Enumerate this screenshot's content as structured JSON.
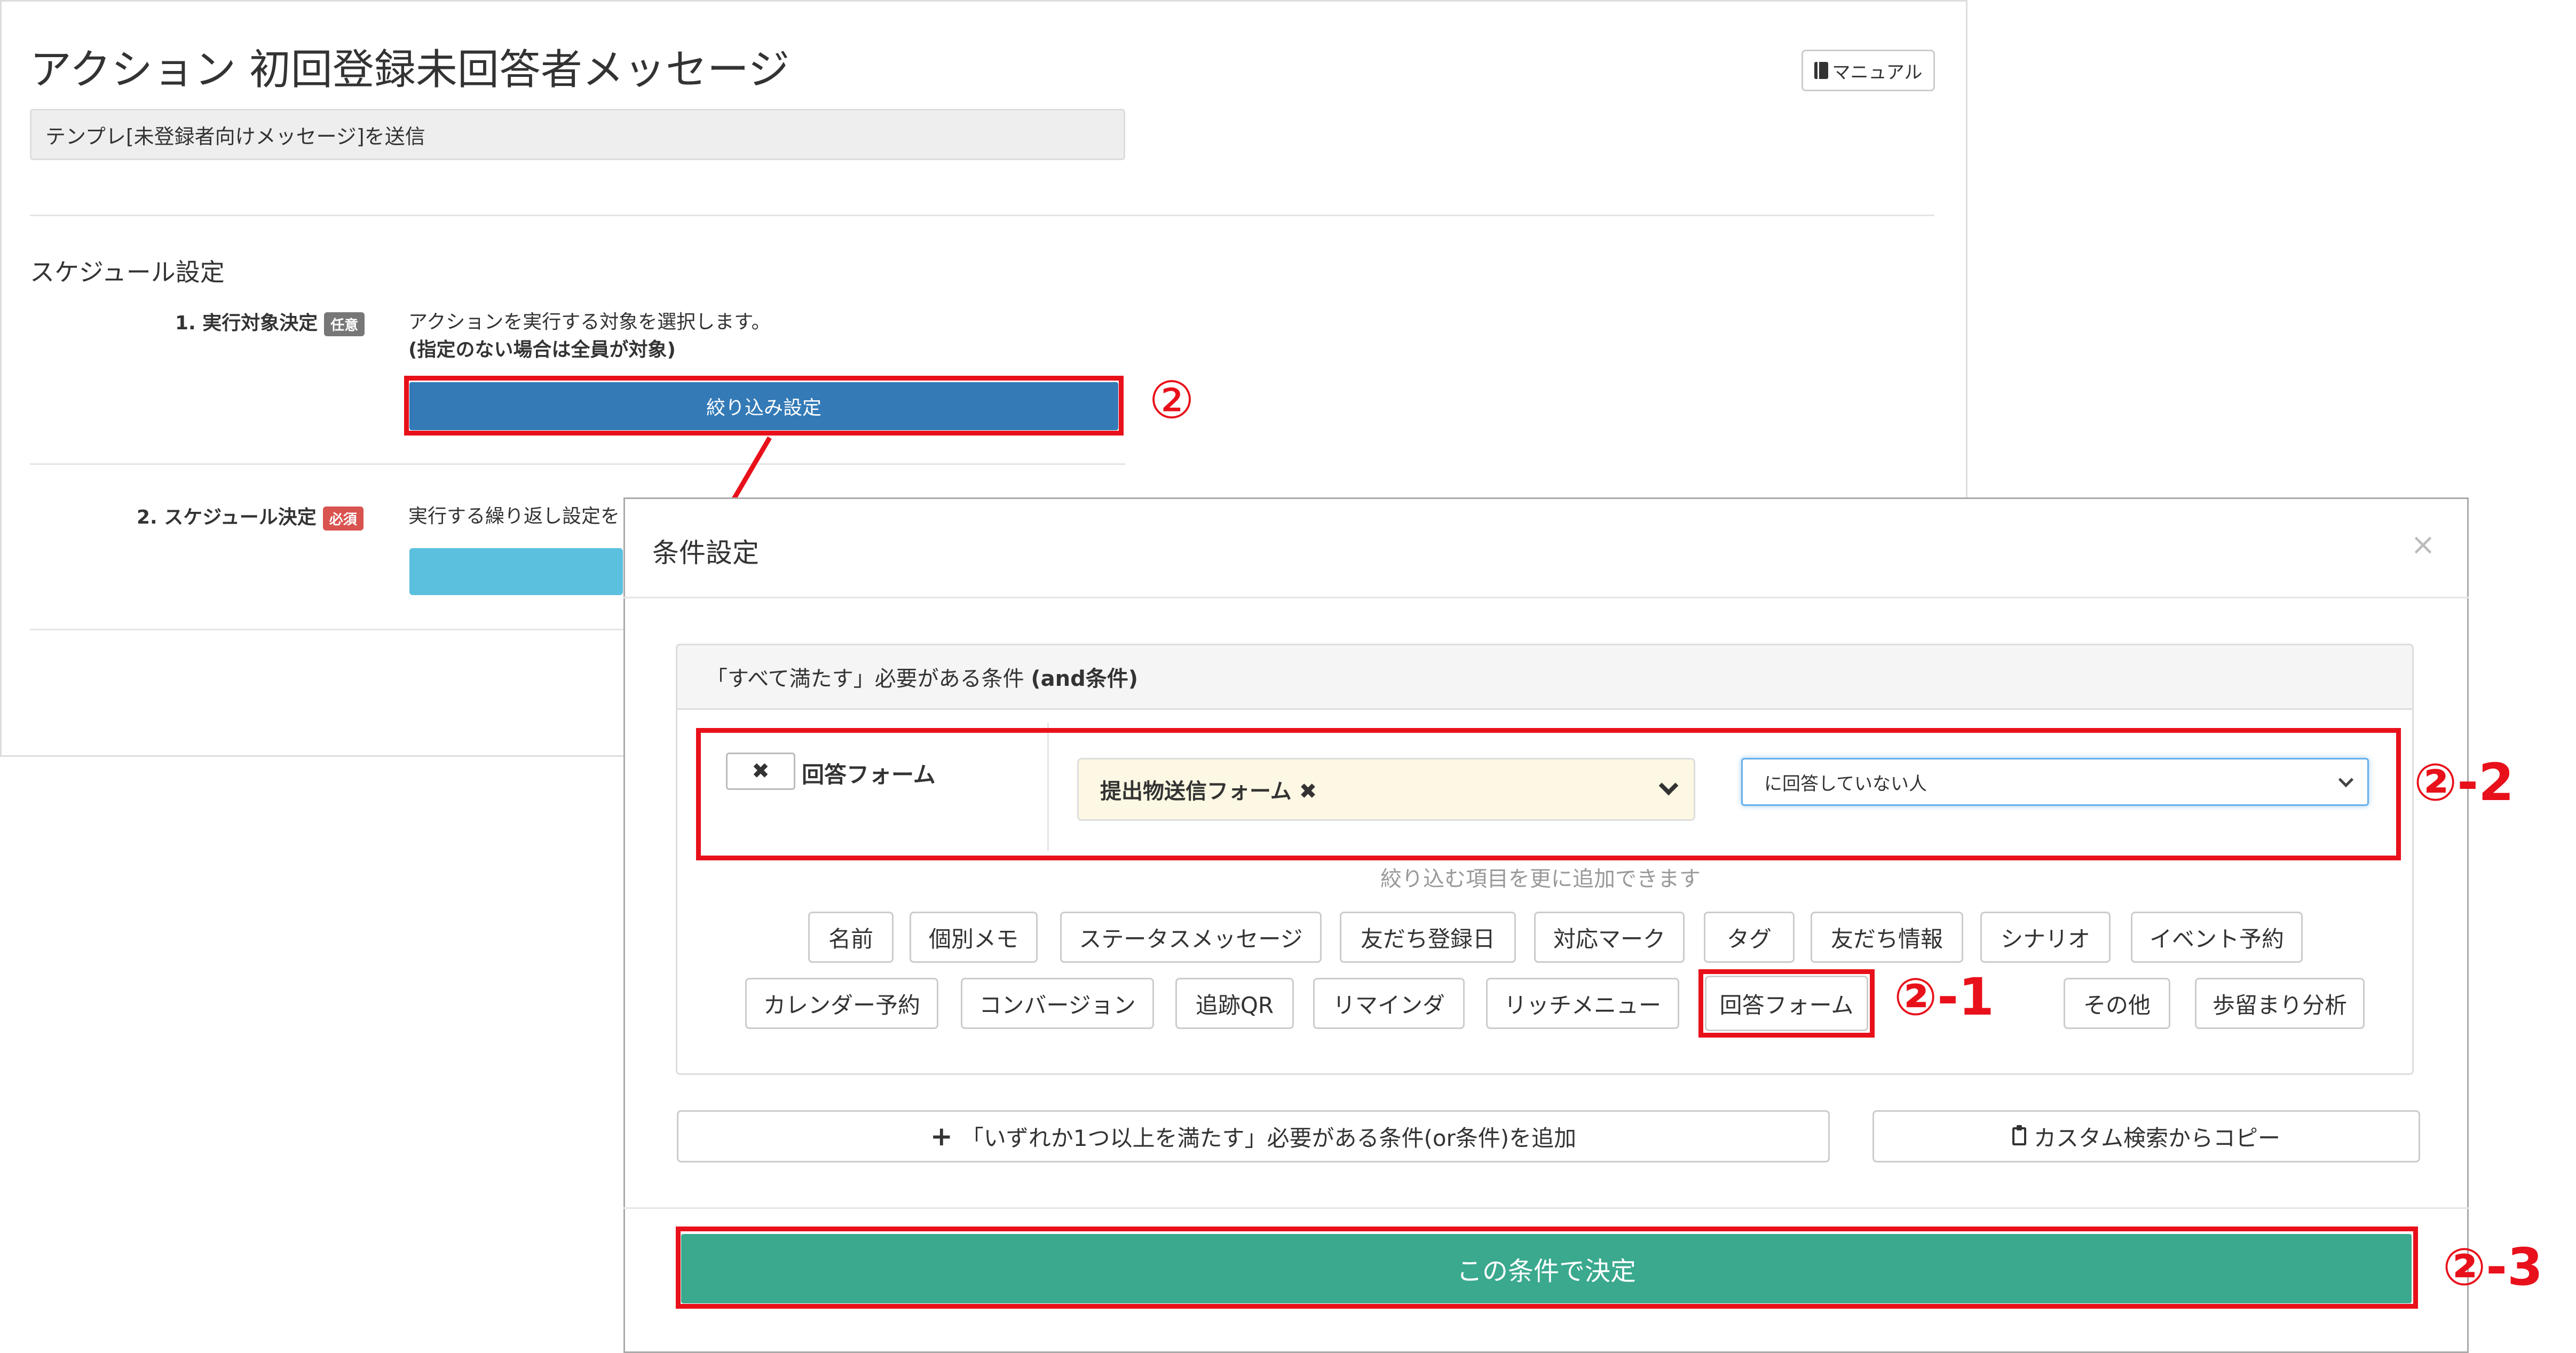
{
  "page": {
    "title": "アクション 初回登録未回答者メッセージ",
    "manual_label": "マニュアル",
    "template_text": "テンプレ[未登録者向けメッセージ]を送信",
    "schedule_title": "スケジュール設定",
    "step1": {
      "label": "1. 実行対象決定",
      "badge": "任意",
      "desc": "アクションを実行する対象を選択します。",
      "note": "(指定のない場合は全員が対象)",
      "button": "絞り込み設定"
    },
    "step2": {
      "label": "2. スケジュール決定",
      "badge": "必須",
      "desc": "実行する繰り返し設定を"
    }
  },
  "modal": {
    "title": "条件設定",
    "close": "×",
    "and_header": "「すべて満たす」必要がある条件",
    "and_header_bold": "(and条件)",
    "condition": {
      "remove": "✖",
      "label": "回答フォーム",
      "selected_form": "提出物送信フォーム ✖",
      "status": "に回答していない人"
    },
    "hint": "絞り込む項目を更に追加できます",
    "chips_row1": [
      "名前",
      "個別メモ",
      "ステータスメッセージ",
      "友だち登録日",
      "対応マーク",
      "タグ",
      "友だち情報",
      "シナリオ",
      "イベント予約"
    ],
    "chips_row2": [
      "カレンダー予約",
      "コンバージョン",
      "追跡QR",
      "リマインダ",
      "リッチメニュー",
      "回答フォーム",
      "その他",
      "歩留まり分析"
    ],
    "or_button": "「いずれか1つ以上を満たす」必要がある条件(or条件)を追加",
    "copy_button": "カスタム検索からコピー",
    "decide_button": "この条件で決定"
  },
  "callouts": {
    "c2": "②",
    "c2_1": "②-1",
    "c2_2": "②-2",
    "c2_3": "②-3"
  },
  "colors": {
    "primary": "#337ab7",
    "info": "#5bc0de",
    "success": "#3aa98e",
    "highlight": "#e8101a",
    "selected_bg": "#fcf8e3"
  }
}
